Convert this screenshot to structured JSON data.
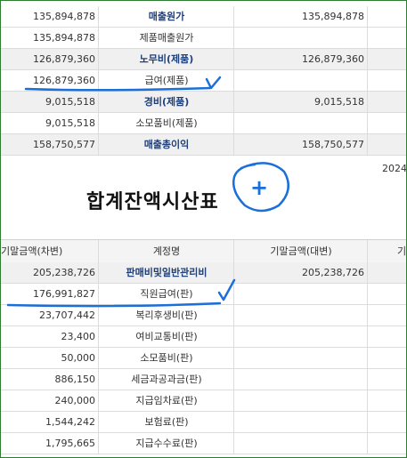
{
  "top_rows": [
    {
      "debit": "135,894,878",
      "account": "매출원가",
      "credit": "135,894,878",
      "bold": true,
      "gray": false
    },
    {
      "debit": "135,894,878",
      "account": "제품매출원가",
      "credit": "",
      "bold": false,
      "gray": false
    },
    {
      "debit": "126,879,360",
      "account": "노무비(제품)",
      "credit": "126,879,360",
      "bold": true,
      "gray": true
    },
    {
      "debit": "126,879,360",
      "account": "급여(제품)",
      "credit": "",
      "bold": false,
      "gray": false
    },
    {
      "debit": "9,015,518",
      "account": "경비(제품)",
      "credit": "9,015,518",
      "bold": true,
      "gray": true
    },
    {
      "debit": "9,015,518",
      "account": "소모품비(제품)",
      "credit": "",
      "bold": false,
      "gray": false
    },
    {
      "debit": "158,750,577",
      "account": "매출총이익",
      "credit": "158,750,577",
      "bold": true,
      "gray": true
    }
  ],
  "report": {
    "title": "합계잔액시산표",
    "date": "2024/"
  },
  "header": {
    "col1": "기말금액(차변)",
    "col2": "계정명",
    "col3": "기말금액(대변)",
    "col4": "기"
  },
  "bottom_rows": [
    {
      "debit": "205,238,726",
      "account": "판매비및일반관리비",
      "credit": "205,238,726",
      "bold": true,
      "gray": true
    },
    {
      "debit": "176,991,827",
      "account": "직원급여(판)",
      "credit": "",
      "bold": false,
      "gray": false
    },
    {
      "debit": "23,707,442",
      "account": "복리후생비(판)",
      "credit": "",
      "bold": false,
      "gray": false
    },
    {
      "debit": "23,400",
      "account": "여비교통비(판)",
      "credit": "",
      "bold": false,
      "gray": false
    },
    {
      "debit": "50,000",
      "account": "소모품비(판)",
      "credit": "",
      "bold": false,
      "gray": false
    },
    {
      "debit": "886,150",
      "account": "세금과공과금(판)",
      "credit": "",
      "bold": false,
      "gray": false
    },
    {
      "debit": "240,000",
      "account": "지급임차료(판)",
      "credit": "",
      "bold": false,
      "gray": false
    },
    {
      "debit": "1,544,242",
      "account": "보험료(판)",
      "credit": "",
      "bold": false,
      "gray": false
    },
    {
      "debit": "1,795,665",
      "account": "지급수수료(판)",
      "credit": "",
      "bold": false,
      "gray": false
    }
  ],
  "annotations": {
    "plus_symbol": "+",
    "pen_color": "#1a6fd8"
  }
}
